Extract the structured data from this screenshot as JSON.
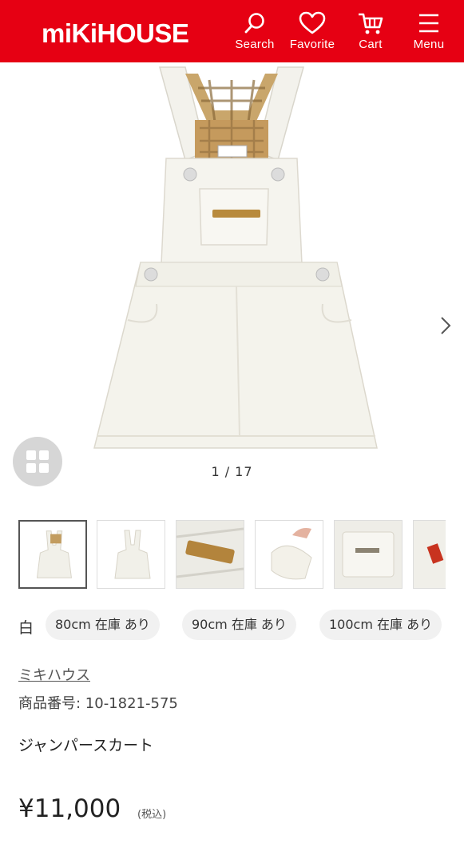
{
  "header": {
    "logo": "miKiHOUSE",
    "nav": [
      {
        "label": "Search",
        "icon": "search-icon"
      },
      {
        "label": "Favorite",
        "icon": "heart-icon"
      },
      {
        "label": "Cart",
        "icon": "cart-icon"
      },
      {
        "label": "Menu",
        "icon": "hamburger-menu-icon"
      }
    ],
    "background": "#e60013"
  },
  "gallery": {
    "counter": "1 / 17",
    "thumbnails": [
      "jumper skirt front",
      "jumper skirt front",
      "logo embroidery detail",
      "hand holding hem",
      "pocket detail",
      "red label detail"
    ]
  },
  "product": {
    "color": "白",
    "sizes": [
      "80cm 在庫 あり",
      "90cm 在庫 あり",
      "100cm 在庫 あり"
    ],
    "brand": "ミキハウス",
    "code": "商品番号: 10-1821-575",
    "name": "ジャンパースカート",
    "price": "¥11,000",
    "tax": "(税込)"
  }
}
